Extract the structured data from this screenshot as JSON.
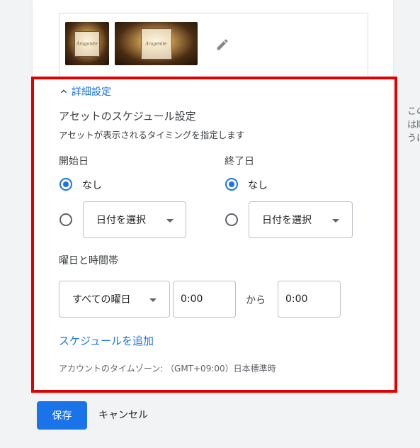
{
  "images": {
    "thumb_square_text": "Aragonite",
    "thumb_wide_text": "Aragonite"
  },
  "advanced": {
    "toggle_label": "詳細設定",
    "schedule_title": "アセットのスケジュール設定",
    "schedule_desc": "アセットが表示されるタイミングを指定します"
  },
  "start_date": {
    "label": "開始日",
    "none_label": "なし",
    "none_selected": true,
    "select_label": "日付を選択"
  },
  "end_date": {
    "label": "終了日",
    "none_label": "なし",
    "none_selected": true,
    "select_label": "日付を選択"
  },
  "daytime": {
    "label": "曜日と時間帯",
    "days_value": "すべての曜日",
    "start_time": "0:00",
    "from_label": "から",
    "end_time": "0:00"
  },
  "add_schedule_label": "スケジュールを追加",
  "timezone_text": "アカウントのタイムゾーン: （GMT+09:00）日本標準時",
  "right_panel": {
    "line1": "この",
    "line2": "は順",
    "line3": "うに"
  },
  "footer": {
    "save_label": "保存",
    "cancel_label": "キャンセル"
  },
  "colors": {
    "accent": "#1a73e8",
    "highlight": "#e00000"
  }
}
